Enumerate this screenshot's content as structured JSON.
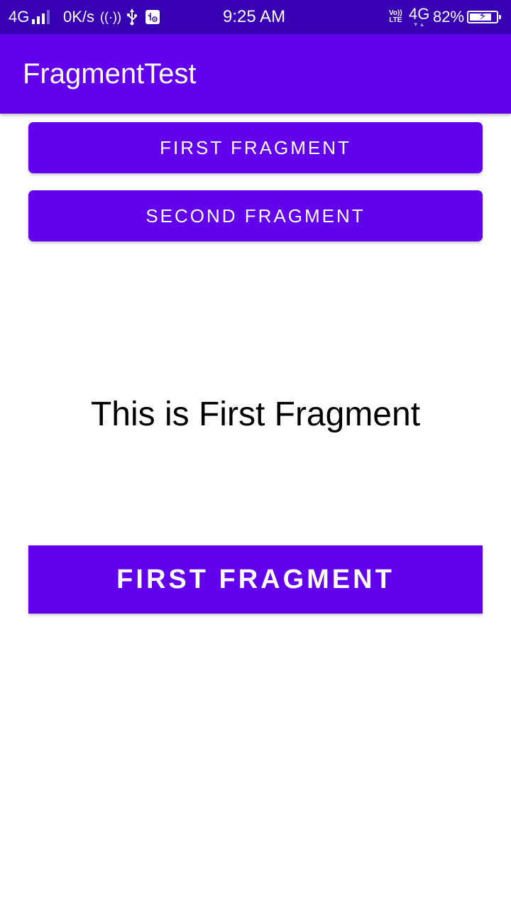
{
  "status_bar": {
    "network_type": "4G",
    "speed": "0K/s",
    "hotspot_glyph": "((·))",
    "time": "9:25 AM",
    "volte_top": "Vo))",
    "volte_bottom": "LTE",
    "network_type_right": "4G",
    "battery_percent": "82%",
    "battery_level": 0.82,
    "icons": [
      "signal-icon",
      "hotspot-icon",
      "usb-icon",
      "usb-debugging-icon",
      "volte-icon",
      "data-activity-icon",
      "battery-charging-icon"
    ]
  },
  "app_bar": {
    "title": "FragmentTest"
  },
  "buttons": {
    "first_fragment": "FIRST FRAGMENT",
    "second_fragment": "SECOND FRAGMENT"
  },
  "fragment": {
    "text": "This is First Fragment",
    "button_label": "FIRST FRAGMENT"
  },
  "colors": {
    "primary": "#6200ee",
    "primary_dark": "#3700b3",
    "on_primary": "#ffffff",
    "background": "#ffffff",
    "text": "#000000"
  }
}
